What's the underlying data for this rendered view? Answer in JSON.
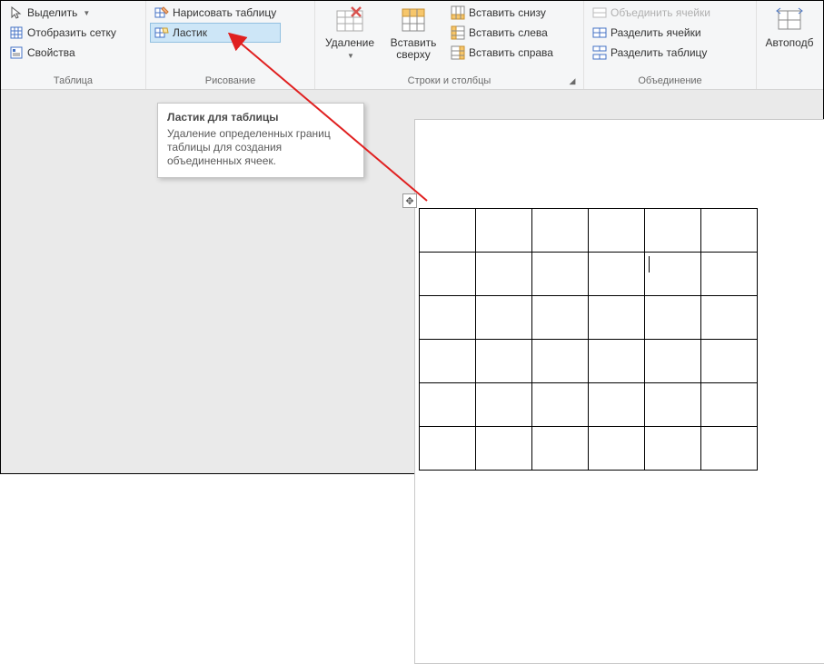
{
  "ribbon": {
    "group_table": {
      "label": "Таблица",
      "select": "Выделить",
      "show_grid": "Отобразить сетку",
      "properties": "Свойства"
    },
    "group_draw": {
      "label": "Рисование",
      "draw_table": "Нарисовать таблицу",
      "eraser": "Ластик"
    },
    "group_rowscols": {
      "label": "Строки и столбцы",
      "delete": "Удаление",
      "insert_top": "Вставить сверху",
      "insert_below": "Вставить снизу",
      "insert_left": "Вставить слева",
      "insert_right": "Вставить справа"
    },
    "group_merge": {
      "label": "Объединение",
      "merge_cells": "Объединить ячейки",
      "split_cells": "Разделить ячейки",
      "split_table": "Разделить таблицу"
    },
    "group_size": {
      "autofit": "Автоподб"
    }
  },
  "tooltip": {
    "title": "Ластик для таблицы",
    "body": "Удаление определенных границ таблицы для создания объединенных ячеек."
  },
  "document": {
    "table": {
      "rows": 6,
      "cols": 6,
      "cursor_row": 1,
      "cursor_col": 4
    }
  }
}
